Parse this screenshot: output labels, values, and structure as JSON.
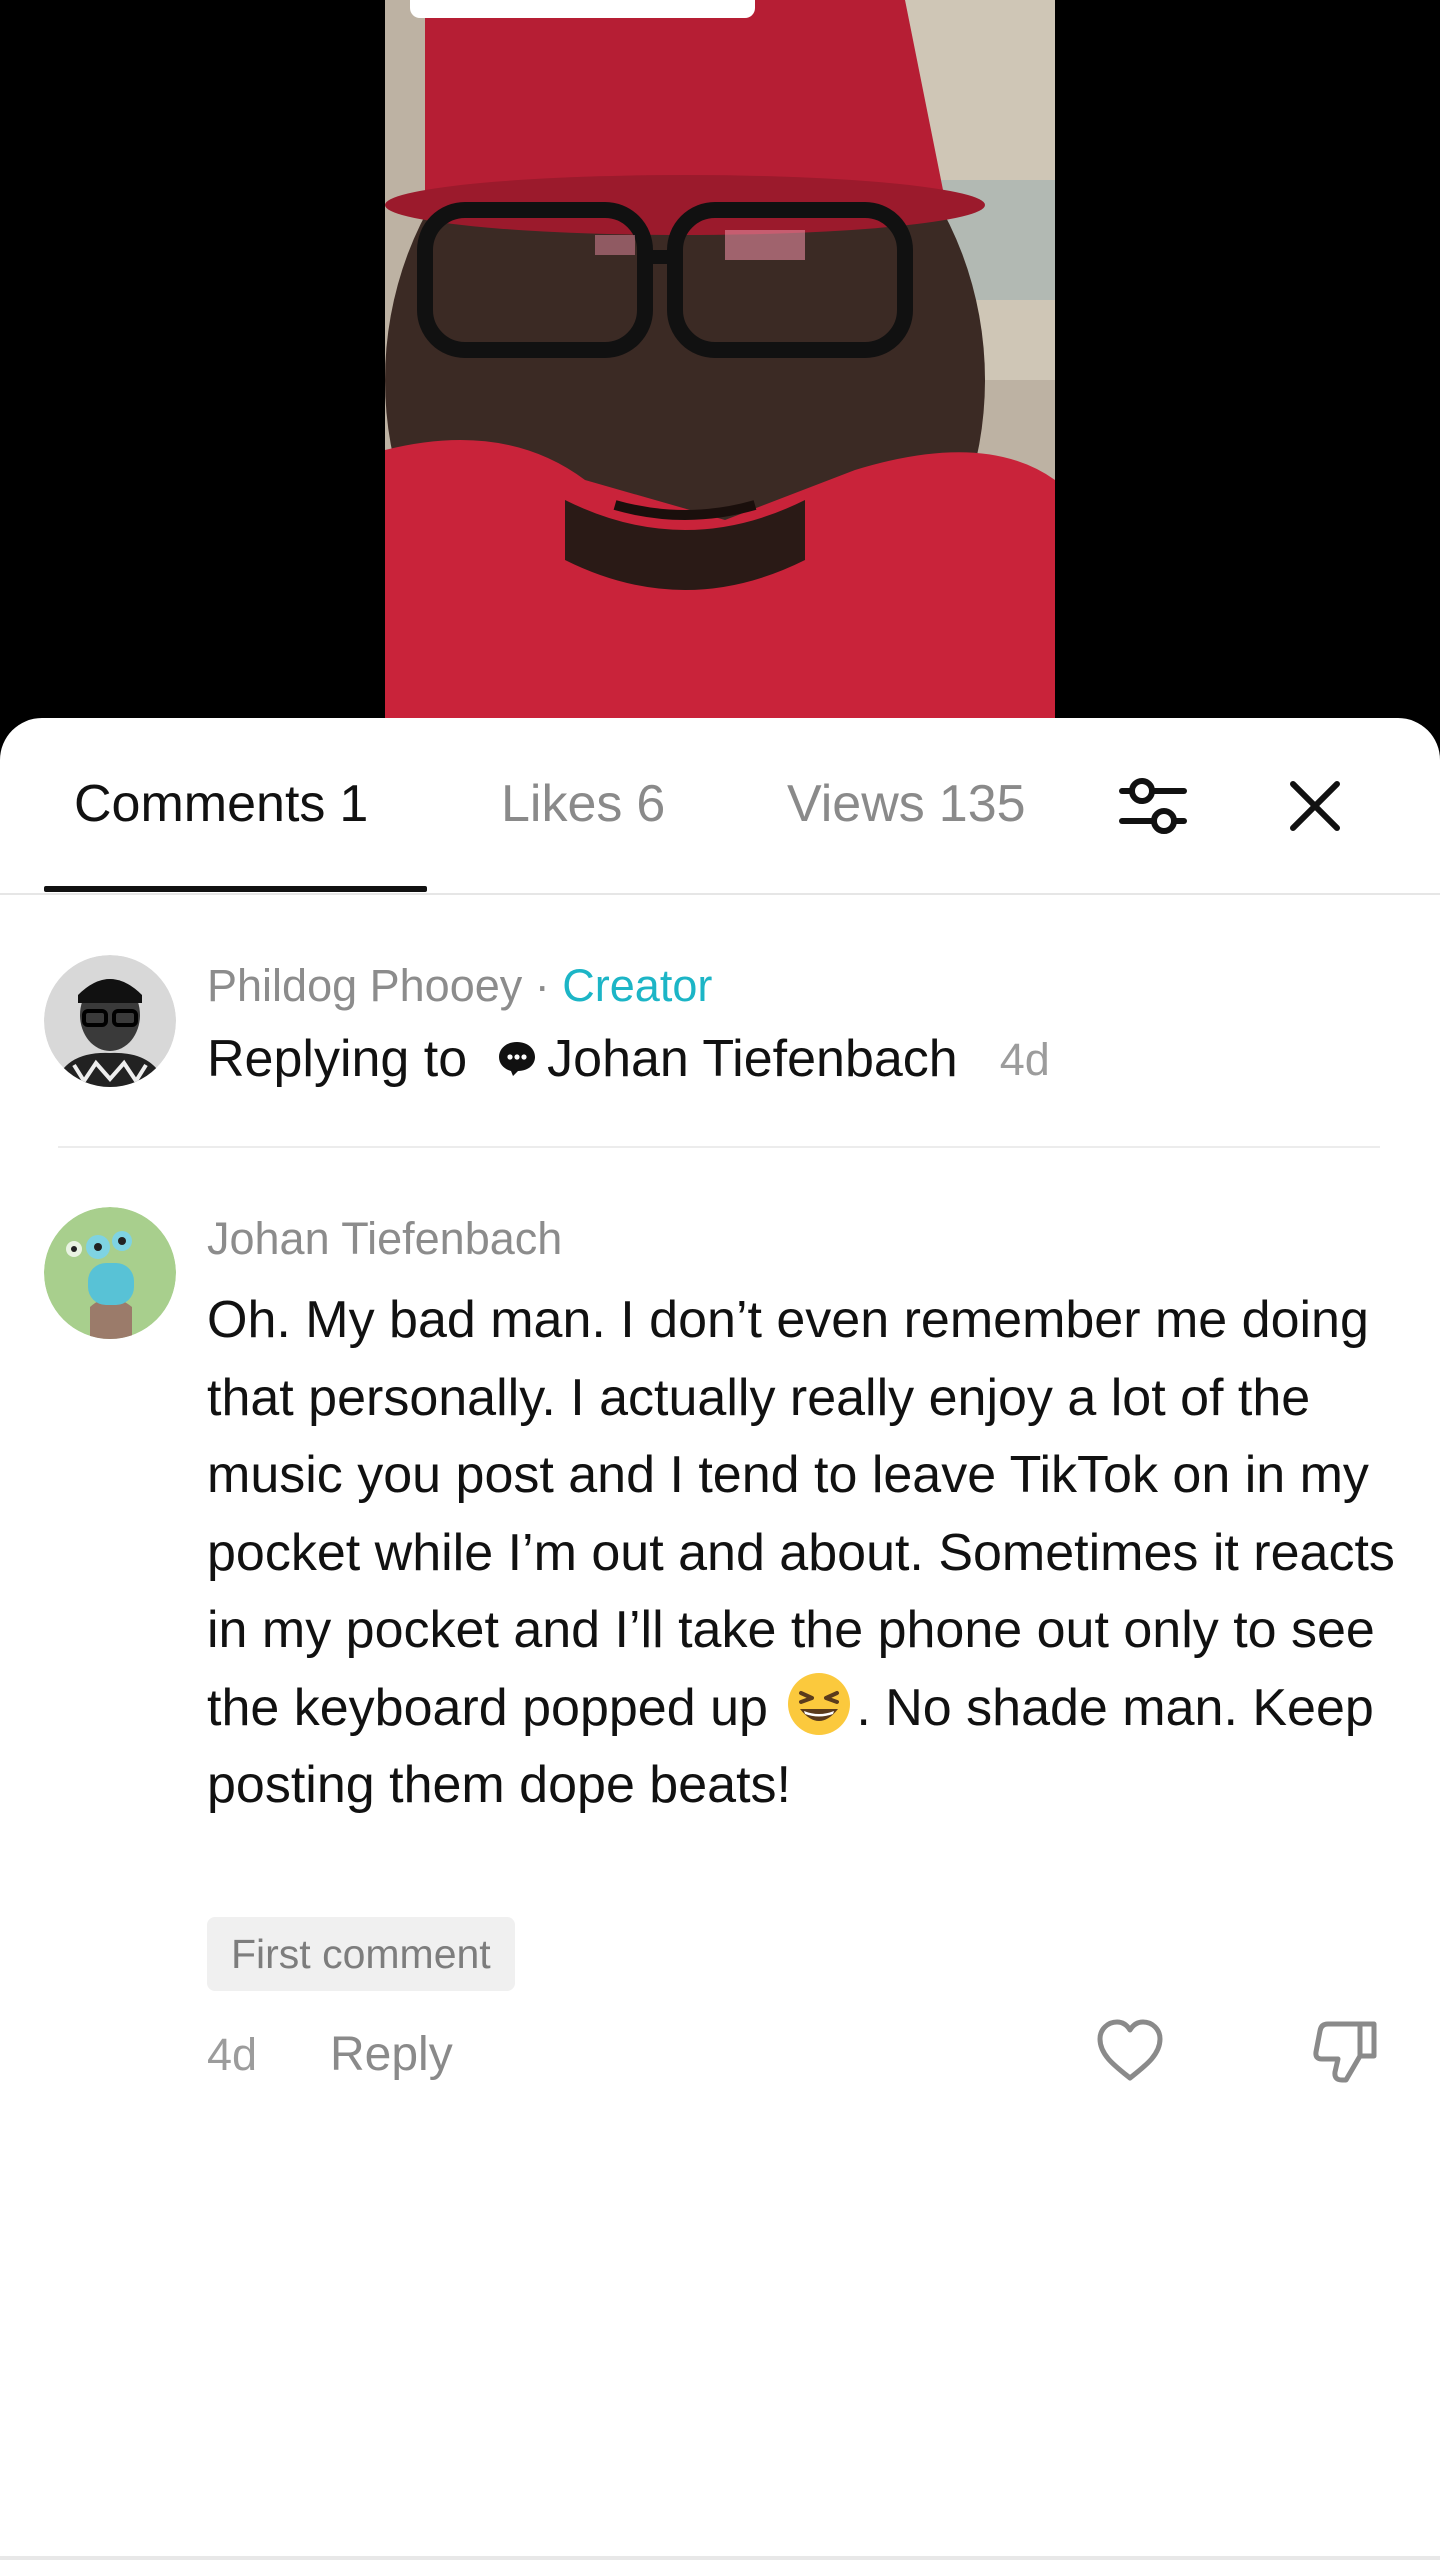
{
  "tabs": [
    {
      "label": "Comments",
      "count": "1"
    },
    {
      "label": "Likes",
      "count": "6"
    },
    {
      "label": "Views",
      "count": "135"
    }
  ],
  "icons": {
    "filter": "sliders-icon",
    "close": "close-icon",
    "like": "heart-icon",
    "dislike": "thumbs-down-icon",
    "reply_bubble": "speech-bubble-icon"
  },
  "colors": {
    "creator_accent": "#1cb5c6",
    "text_primary": "#111111",
    "text_secondary": "#8c8c8c"
  },
  "creator_reply": {
    "author": "Phildog Phooey",
    "separator": "·",
    "badge": "Creator",
    "replying_prefix": "Replying to",
    "replying_to": "Johan Tiefenbach",
    "time": "4d"
  },
  "comment": {
    "author": "Johan Tiefenbach",
    "text_part1": "Oh. My bad man. I don’t even remember me doing that personally. I actually really enjoy a lot of the music you post and I tend to leave TikTok on in my pocket while I’m out and about. Sometimes it reacts in my pocket and I’ll take the phone out only to see the keyboard popped up",
    "text_part2": ". No shade man. Keep posting them dope beats!",
    "badge": "First comment",
    "time": "4d",
    "reply_label": "Reply"
  }
}
